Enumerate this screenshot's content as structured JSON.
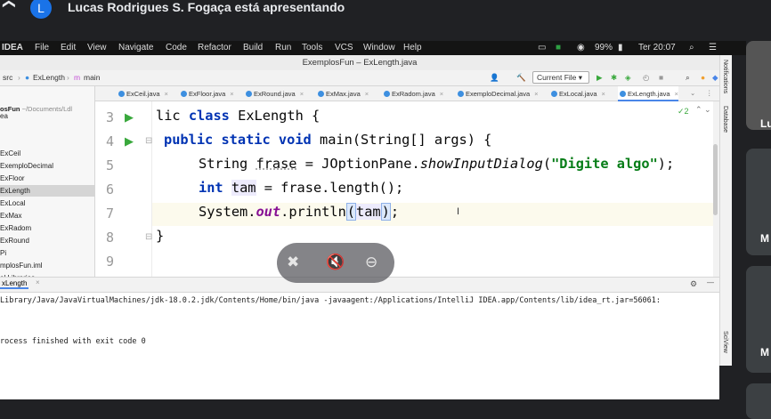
{
  "meet": {
    "avatar_letter": "L",
    "presenting_text": "Lucas Rodrigues S. Fogaça está apresentando",
    "tile1_label": "Lu",
    "tile2_label": "M",
    "tile3_label": "M"
  },
  "macbar": {
    "app": "IDEA",
    "menu": [
      "File",
      "Edit",
      "View",
      "Navigate",
      "Code",
      "Refactor",
      "Build",
      "Run",
      "Tools",
      "VCS",
      "Window",
      "Help"
    ],
    "battery": "99%",
    "clock": "Ter 20:07"
  },
  "ide": {
    "window_title": "ExemplosFun – ExLength.java",
    "breadcrumb": [
      "src",
      "ExLength",
      "main"
    ],
    "run_config": "Current File",
    "tabs": [
      "ExCeil.java",
      "ExFloor.java",
      "ExRound.java",
      "ExMax.java",
      "ExRadom.java",
      "ExemploDecimal.java",
      "ExLocal.java",
      "ExLength.java"
    ],
    "active_tab": "ExLength.java",
    "inspection_count": "2",
    "project_path": "~/Documents/Ldl",
    "project_root": "osFun",
    "project_items": [
      "ea",
      "ExCeil",
      "ExemploDecimal",
      "ExFloor",
      "ExLength",
      "ExLocal",
      "ExMax",
      "ExRadom",
      "ExRound",
      "Pi",
      "mplosFun.iml",
      "al Libraries"
    ],
    "selected_project_item": "ExLength",
    "line_numbers": [
      "3",
      "4",
      "5",
      "6",
      "7",
      "8",
      "9"
    ],
    "code": {
      "l3": [
        "lic ",
        "class",
        " ExLength {"
      ],
      "l4": [
        "public static void",
        " main(String[] args) {"
      ],
      "l5": [
        "String ",
        "frase",
        " = JOptionPane.",
        "showInputDialog",
        "(",
        "\"Digite algo\"",
        ");"
      ],
      "l6": [
        "int",
        " ",
        "tam",
        " = frase.length();"
      ],
      "l7": [
        "System.",
        "out",
        ".println",
        "(",
        "tam",
        ")",
        ";"
      ],
      "l8": [
        "}"
      ]
    },
    "right_tools": [
      "Notifications",
      "Database",
      "SciView"
    ],
    "console": {
      "tab": "xLength",
      "command": "Library/Java/JavaVirtualMachines/jdk-18.0.2.jdk/Contents/Home/bin/java -javaagent:/Applications/IntelliJ IDEA.app/Contents/lib/idea_rt.jar=56061:",
      "exit": "rocess finished with exit code 0"
    }
  }
}
